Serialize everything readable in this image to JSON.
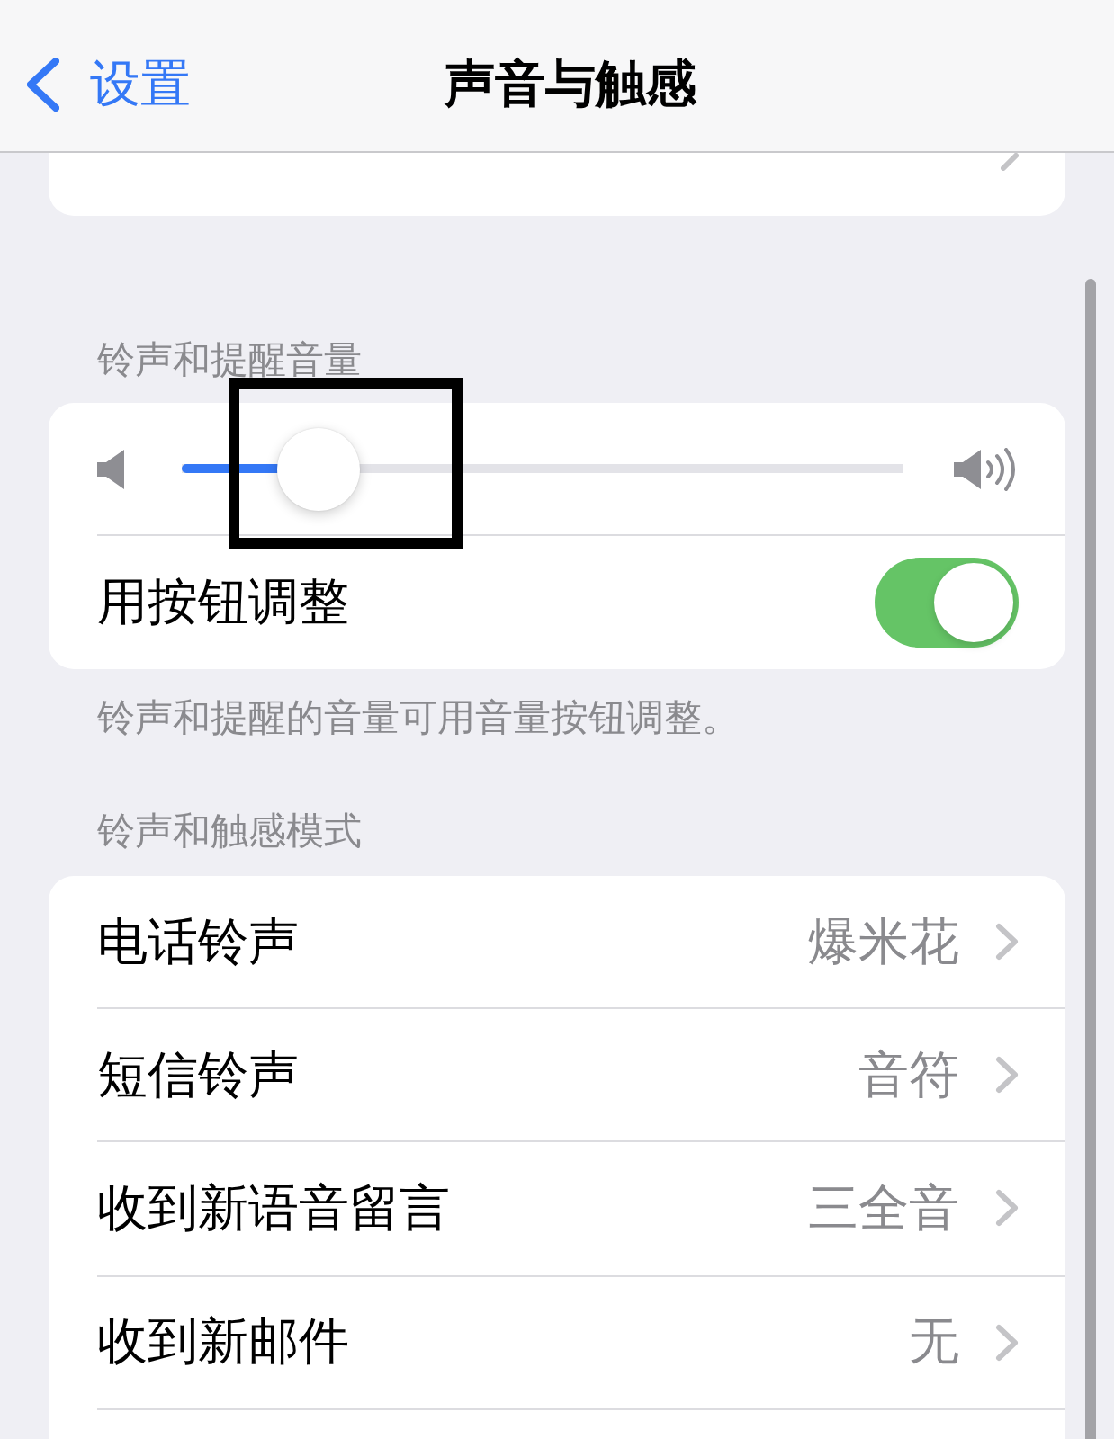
{
  "nav_bar": {
    "back_label": "设置",
    "title": "声音与触感"
  },
  "ringer_volume": {
    "header": "铃声和提醒音量",
    "level": 0.19,
    "adjust_with_buttons": {
      "label": "用按钮调整",
      "on": true
    },
    "footer": "铃声和提醒的音量可用音量按钮调整。"
  },
  "ringtones": {
    "header": "铃声和触感模式",
    "rows": [
      {
        "label": "电话铃声",
        "value": "爆米花"
      },
      {
        "label": "短信铃声",
        "value": "音符"
      },
      {
        "label": "收到新语音留言",
        "value": "三全音"
      },
      {
        "label": "收到新邮件",
        "value": "无"
      }
    ]
  }
}
